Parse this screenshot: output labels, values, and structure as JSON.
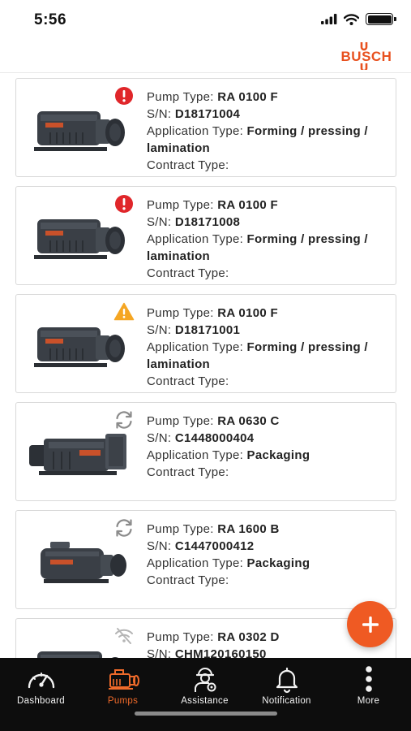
{
  "status_bar": {
    "time": "5:56"
  },
  "header": {
    "logo_text": "BUSCH",
    "brand_color": "#e8511f"
  },
  "labels": {
    "pump_type": "Pump Type:",
    "serial": "S/N:",
    "application_type": "Application Type:",
    "contract_type": "Contract Type:"
  },
  "pumps": [
    {
      "pump_type": "RA 0100 F",
      "serial": "D18171004",
      "application_type": "Forming / pressing / lamination",
      "contract_type": "",
      "status_icon": "error-icon"
    },
    {
      "pump_type": "RA 0100 F",
      "serial": "D18171008",
      "application_type": "Forming / pressing / lamination",
      "contract_type": "",
      "status_icon": "error-icon"
    },
    {
      "pump_type": "RA 0100 F",
      "serial": "D18171001",
      "application_type": "Forming / pressing / lamination",
      "contract_type": "",
      "status_icon": "warning-icon"
    },
    {
      "pump_type": "RA 0630 C",
      "serial": "C1448000404",
      "application_type": "Packaging",
      "contract_type": "",
      "status_icon": "sync-icon"
    },
    {
      "pump_type": "RA 1600 B",
      "serial": "C1447000412",
      "application_type": "Packaging",
      "contract_type": "",
      "status_icon": "sync-icon"
    },
    {
      "pump_type": "RA 0302 D",
      "serial": "CHM120160150",
      "application_type": "",
      "contract_type": "",
      "status_icon": "no-signal-icon"
    }
  ],
  "fab": {
    "icon": "plus-icon",
    "color": "#ef5a23"
  },
  "tab_bar": {
    "active_color": "#ef6a2a",
    "tabs": [
      {
        "label": "Dashboard",
        "icon": "speedometer-icon"
      },
      {
        "label": "Pumps",
        "icon": "pump-icon"
      },
      {
        "label": "Assistance",
        "icon": "technician-icon"
      },
      {
        "label": "Notification",
        "icon": "bell-icon"
      },
      {
        "label": "More",
        "icon": "more-vertical-icon"
      }
    ]
  }
}
